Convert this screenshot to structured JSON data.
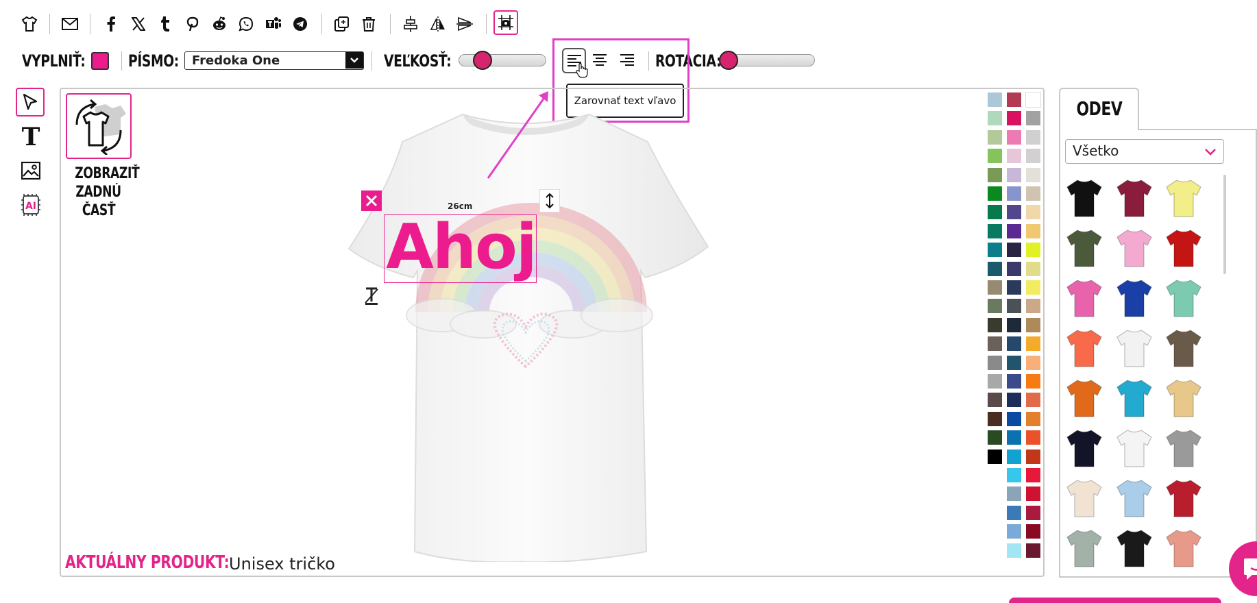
{
  "colors": {
    "accent": "#e3248a",
    "highlight": "#e040c8",
    "fill_color": "#ec1c8e",
    "thumb": "#d6246e"
  },
  "toolbar": {
    "icons": [
      "tshirt-icon",
      "mail-icon",
      "facebook-icon",
      "x-twitter-icon",
      "tumblr-icon",
      "pinterest-icon",
      "reddit-icon",
      "whatsapp-icon",
      "teams-icon",
      "telegram-icon",
      "duplicate-icon",
      "trash-icon",
      "align-center-vertical-icon",
      "flip-horizontal-icon",
      "flip-vertical-icon",
      "grid-icon"
    ]
  },
  "props": {
    "fill_label": "VYPLNIŤ:",
    "font_label": "PÍSMO:",
    "font_value": "Fredoka One",
    "size_label": "VEĽKOSŤ:",
    "size_value": 0.2,
    "rotation_label": "ROTÁCIA:",
    "rotation_value": 0.0,
    "tooltip": "Zarovnať text vľavo"
  },
  "left_tools": [
    "select-icon",
    "text-icon",
    "image-icon",
    "ai-icon"
  ],
  "canvas": {
    "back_side_label": [
      "ZOBRAZIŤ",
      "ZADNÚ",
      "ČASŤ"
    ],
    "text_object": "Ahoj",
    "dimension": "26cm",
    "current_product_label": "AKTUÁLNY PRODUKT:",
    "current_product_value": "Unisex tričko"
  },
  "palette": {
    "col1": [
      "#aac8d8",
      "#b0d8bc",
      "#b4c99a",
      "#84c45a",
      "#7a9a58",
      "#0a8a1e",
      "#067a4a",
      "#087a62",
      "#0a7e8c",
      "#1a5a6a",
      "#968a72",
      "#6a7a5e",
      "#3a3a2e",
      "#6a625a",
      "#8a8a8a",
      "#a8a8a8",
      "#5a4a4a",
      "#4a2e22",
      "#2a4a22",
      "#000000"
    ],
    "col2": [
      "#b23a52",
      "#d8125e",
      "#ee7ab4",
      "#e6c6d8",
      "#c8b8d8",
      "#8894cc",
      "#52468c",
      "#5a2a92",
      "#2a2444",
      "#3a3a6a",
      "#2a3a5a",
      "#4a5258",
      "#1e2a3a",
      "#26486a",
      "#22546c",
      "#3a4a8a",
      "#1e2e5a",
      "#0a4aa2",
      "#0a72ae",
      "#12a2d2",
      "#38c6ec",
      "#8aa4b8",
      "#3a7ab6",
      "#7aaad8",
      "#a2e6f4"
    ],
    "col3": [
      "#ffffff",
      "#a2a2a2",
      "#d0d0d0",
      "#d2d0d0",
      "#e2e0d8",
      "#d0c4b0",
      "#f0d8aa",
      "#f0c870",
      "#e2f026",
      "#e0dc8a",
      "#f4ec60",
      "#caa888",
      "#ae8a5a",
      "#f4aa2a",
      "#f8b078",
      "#f87a12",
      "#e26a4a",
      "#e2802e",
      "#ea522a",
      "#c2361a",
      "#e8183a",
      "#d01232",
      "#aa1a3e",
      "#8a0a22",
      "#6a1a30"
    ]
  },
  "side_panel": {
    "tab": "ODEV",
    "filter_value": "Všetko",
    "products": [
      {
        "name": "black-tshirt",
        "color": "#111111"
      },
      {
        "name": "maroon-tshirt",
        "color": "#8a1c3c"
      },
      {
        "name": "yellow-tshirt",
        "color": "#f2ee8a"
      },
      {
        "name": "olive-tshirt",
        "color": "#4a5a3a"
      },
      {
        "name": "pink-tshirt",
        "color": "#f4aad0"
      },
      {
        "name": "red-tshirt",
        "color": "#c41414"
      },
      {
        "name": "hotpink-tshirt",
        "color": "#e862ac"
      },
      {
        "name": "royal-blue-tshirt",
        "color": "#1a40a8"
      },
      {
        "name": "mint-tshirt",
        "color": "#7ccab0"
      },
      {
        "name": "coral-tshirt",
        "color": "#f86a4a"
      },
      {
        "name": "white-tanktop",
        "color": "#f2f2f2"
      },
      {
        "name": "brown-tanktop",
        "color": "#6a5a4a"
      },
      {
        "name": "orange-hoodie",
        "color": "#e06a1a"
      },
      {
        "name": "cyan-hoodie",
        "color": "#22aad0"
      },
      {
        "name": "tiedye-tshirt",
        "color": "#e8c88a"
      },
      {
        "name": "navy-tshirt",
        "color": "#141428"
      },
      {
        "name": "raglan-tshirt",
        "color": "#f4f4f4"
      },
      {
        "name": "grey-hoodie",
        "color": "#9a9a9a"
      },
      {
        "name": "peach-tshirt",
        "color": "#f2e2d2"
      },
      {
        "name": "ombre-tshirt",
        "color": "#aacdea"
      },
      {
        "name": "varsity-jacket",
        "color": "#b81e2e"
      },
      {
        "name": "sage-longsleeve",
        "color": "#a2b2a8"
      },
      {
        "name": "black-orange-hoodie",
        "color": "#1a1a1a"
      },
      {
        "name": "salmon-tanktop",
        "color": "#e89a8a"
      }
    ]
  }
}
